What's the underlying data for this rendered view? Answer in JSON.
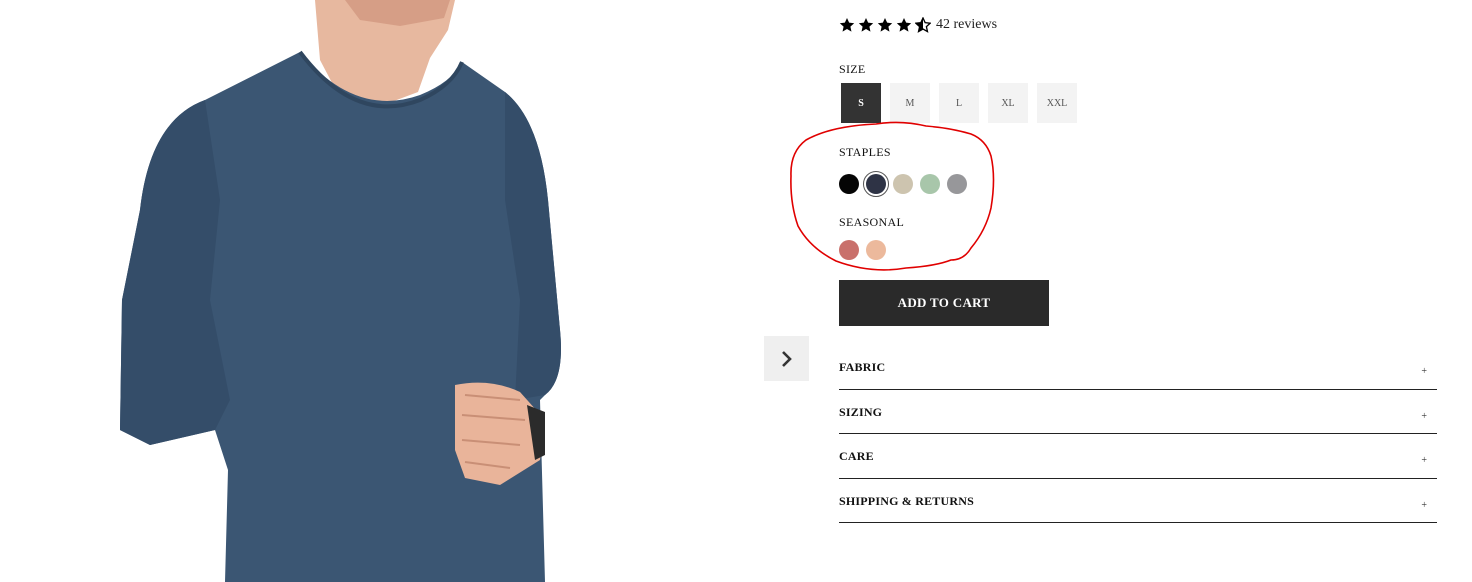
{
  "product": {
    "rating": 4.5,
    "reviews_label": "42 reviews"
  },
  "size": {
    "label": "SIZE",
    "options": [
      "S",
      "M",
      "L",
      "XL",
      "XXL"
    ],
    "selected": "S"
  },
  "staples": {
    "label": "STAPLES",
    "colors": [
      "#050505",
      "#2e3345",
      "#cdc4af",
      "#a8c6aa",
      "#97979a"
    ],
    "selected_index": 1
  },
  "seasonal": {
    "label": "SEASONAL",
    "colors": [
      "#c9706b",
      "#ecb99c"
    ]
  },
  "cart": {
    "label": "ADD TO CART"
  },
  "accordions": [
    {
      "title": "FABRIC",
      "icon": "+"
    },
    {
      "title": "SIZING",
      "icon": "+"
    },
    {
      "title": "CARE",
      "icon": "+"
    },
    {
      "title": "SHIPPING & RETURNS",
      "icon": "+"
    }
  ],
  "colors": {
    "annotation": "#e00000",
    "shirt": "#3b5673",
    "button_dark": "#2a2a2a"
  }
}
